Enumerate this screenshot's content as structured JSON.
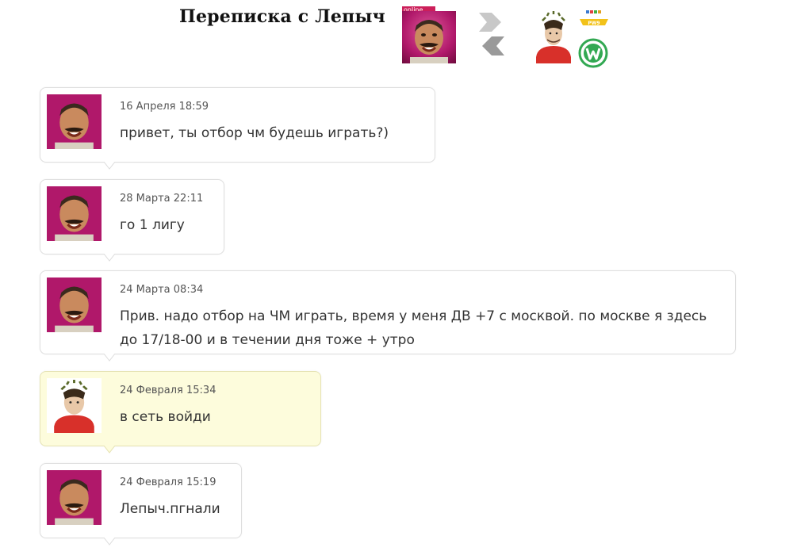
{
  "header": {
    "title": "Переписка с Лепыч",
    "online_label": "online",
    "team_badge_text": "PW9"
  },
  "colors": {
    "online_tag": "#cc1f5a",
    "bubble_border": "#dedede",
    "mine_bubble_bg": "#fdfcdc",
    "club_green": "#32a852"
  },
  "messages": [
    {
      "date": "16 Апреля 18:59",
      "text": "привет, ты отбор чм будешь играть?)",
      "author": "Лепыч"
    },
    {
      "date": "28 Марта 22:11",
      "text": "го 1 лигу",
      "author": "Лепыч"
    },
    {
      "date": "24 Марта 08:34",
      "text": "Прив. надо отбор на ЧМ играть, время у меня ДВ +7 с москвой. по москве я здесь до 17/18-00 и в течении дня тоже + утро",
      "author": "Лепыч"
    },
    {
      "date": "24 Февраля 15:34",
      "text": "в сеть войди",
      "author": "me"
    },
    {
      "date": "24 Февраля 15:19",
      "text": "Лепыч.пгнали",
      "author": "Лепыч"
    }
  ]
}
